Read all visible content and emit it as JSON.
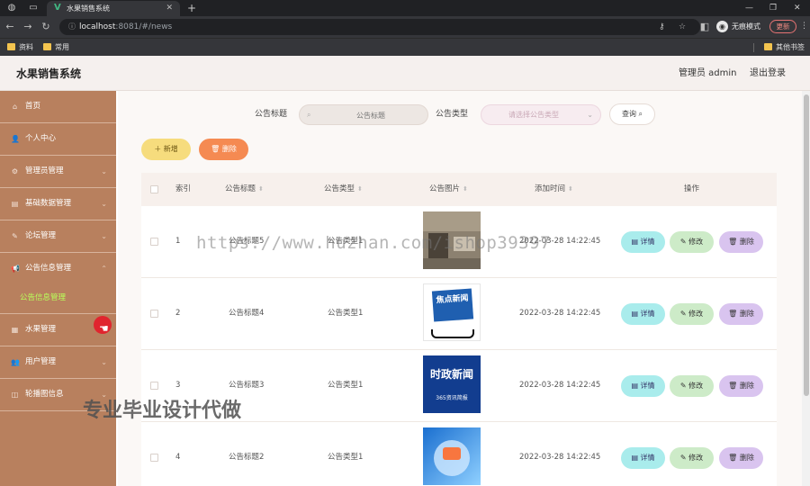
{
  "browser": {
    "tab_title": "水果销售系统",
    "url_host": "localhost",
    "url_rest": ":8081/#/news",
    "profile_label": "无痕模式",
    "update_label": "更新",
    "bookmarks": [
      "资料",
      "常用"
    ],
    "bookmarks_right": "其他书签"
  },
  "header": {
    "title": "水果销售系统",
    "admin": "管理员 admin",
    "logout": "退出登录"
  },
  "sidebar": {
    "items": [
      {
        "label": "首页",
        "icon": "home-icon"
      },
      {
        "label": "个人中心",
        "icon": "user-icon"
      },
      {
        "label": "管理员管理",
        "icon": "admin-icon"
      },
      {
        "label": "基础数据管理",
        "icon": "data-icon"
      },
      {
        "label": "论坛管理",
        "icon": "forum-icon"
      },
      {
        "label": "公告信息管理",
        "icon": "notice-icon"
      },
      {
        "label": "水果管理",
        "icon": "fruit-icon"
      },
      {
        "label": "用户管理",
        "icon": "users-icon"
      },
      {
        "label": "轮播图信息",
        "icon": "carousel-icon"
      }
    ],
    "sub_active": "公告信息管理"
  },
  "search": {
    "title_label": "公告标题",
    "title_placeholder": "公告标题",
    "type_label": "公告类型",
    "type_placeholder": "请选择公告类型",
    "query_label": "查询"
  },
  "actions": {
    "add_label": "新增",
    "delete_label": "删除"
  },
  "table": {
    "headers": {
      "index": "索引",
      "title": "公告标题",
      "type": "公告类型",
      "image": "公告图片",
      "time": "添加时间",
      "ops": "操作"
    },
    "rows": [
      {
        "index": "1",
        "title": "公告标题5",
        "type": "公告类型1",
        "time": "2022-03-28 14:22:45",
        "image": "news-photo-gray"
      },
      {
        "index": "2",
        "title": "公告标题4",
        "type": "公告类型1",
        "time": "2022-03-28 14:22:45",
        "image": "news-badge-blue",
        "image_text": "焦点新闻"
      },
      {
        "index": "3",
        "title": "公告标题3",
        "type": "公告类型1",
        "time": "2022-03-28 14:22:45",
        "image": "news-banner-blue",
        "image_text": "时政新闻",
        "image_sub": "365资讯简报"
      },
      {
        "index": "4",
        "title": "公告标题2",
        "type": "公告类型1",
        "time": "2022-03-28 14:22:45",
        "image": "news-abstract-blue"
      }
    ],
    "op_labels": {
      "detail": "详情",
      "edit": "修改",
      "delete": "删除"
    }
  },
  "watermarks": {
    "url": "https://www.huzhan.com/ishop39397",
    "text": "专业毕业设计代做"
  },
  "colors": {
    "sidebar": "#b8805e",
    "sidebar_active": "#b9ff5a",
    "add_button": "#f6dc7d",
    "delete_button": "#f58a52",
    "detail_button": "#a9ecec",
    "edit_button": "#cdebc8",
    "row_delete_button": "#d9c4ef"
  }
}
